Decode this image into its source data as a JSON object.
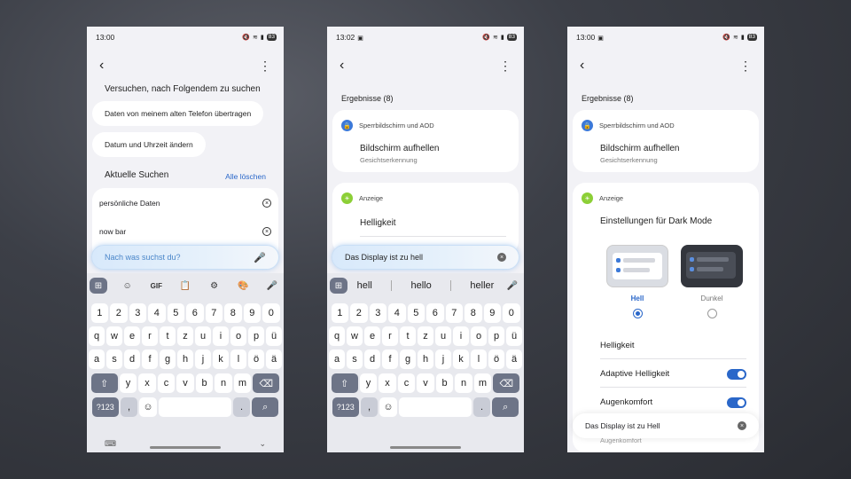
{
  "p1": {
    "time": "13:00",
    "battery": "83",
    "prompt": "Versuchen, nach Folgendem zu suchen",
    "chips": [
      "Daten von meinem alten Telefon übertragen",
      "Datum und Uhrzeit ändern"
    ],
    "recent_title": "Aktuelle Suchen",
    "clear_all": "Alle löschen",
    "recent": [
      "persönliche Daten",
      "now bar"
    ],
    "search_placeholder": "Nach was suchst du?",
    "toolbar": [
      "GIF"
    ]
  },
  "p2": {
    "time": "13:02",
    "battery": "83",
    "results": "Ergebnisse (8)",
    "card1": {
      "category": "Sperrbildschirm und AOD",
      "title": "Bildschirm aufhellen",
      "sub": "Gesichtserkennung"
    },
    "card2": {
      "category": "Anzeige",
      "title": "Helligkeit"
    },
    "query": "Das Display ist zu hell",
    "suggestions": [
      "hell",
      "hello",
      "heller"
    ]
  },
  "p3": {
    "time": "13:00",
    "battery": "83",
    "results": "Ergebnisse (8)",
    "card1": {
      "category": "Sperrbildschirm und AOD",
      "title": "Bildschirm aufhellen",
      "sub": "Gesichtserkennung"
    },
    "card2": {
      "category": "Anzeige",
      "title": "Einstellungen für Dark Mode",
      "light": "Hell",
      "dark": "Dunkel",
      "brightness": "Helligkeit",
      "adaptive": "Adaptive Helligkeit",
      "eye": "Augenkomfort",
      "cut": "Augenkomfort"
    },
    "query": "Das Display ist zu Hell"
  },
  "keyboard": {
    "numbers": [
      "1",
      "2",
      "3",
      "4",
      "5",
      "6",
      "7",
      "8",
      "9",
      "0"
    ],
    "row1": [
      "q",
      "w",
      "e",
      "r",
      "t",
      "z",
      "u",
      "i",
      "o",
      "p",
      "ü"
    ],
    "row2": [
      "a",
      "s",
      "d",
      "f",
      "g",
      "h",
      "j",
      "k",
      "l",
      "ö",
      "ä"
    ],
    "row3": [
      "y",
      "x",
      "c",
      "v",
      "b",
      "n",
      "m"
    ],
    "sym": "?123",
    "comma": ",",
    "period": "."
  }
}
